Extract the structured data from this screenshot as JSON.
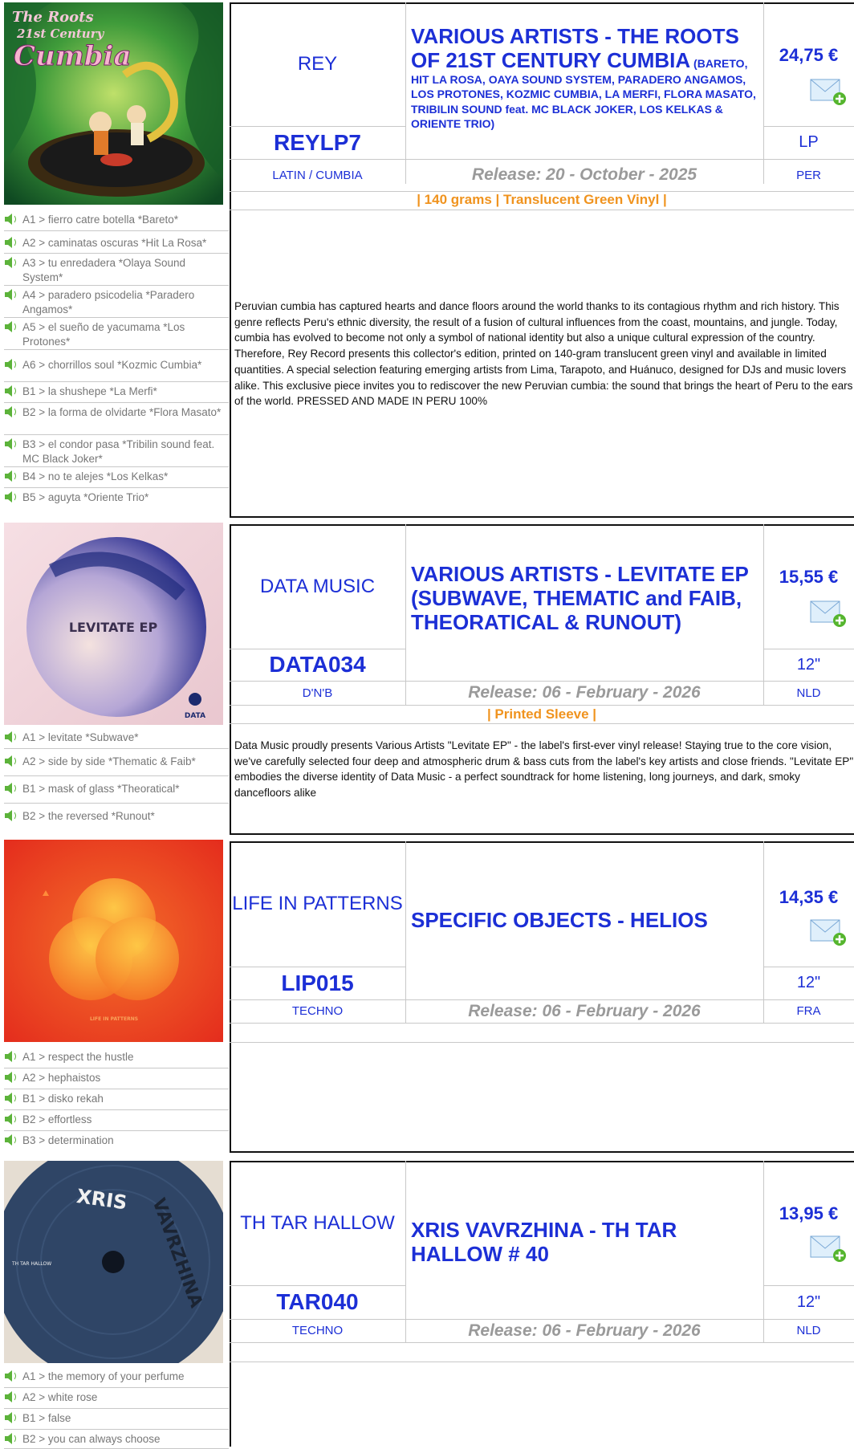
{
  "products": [
    {
      "label": "REY",
      "catalog": "REYLP7",
      "genre": "LATIN / CUMBIA",
      "release": "Release: 20 - October - 2025",
      "format": "LP",
      "country": "PER",
      "price": "24,75 €",
      "title_main": "VARIOUS ARTISTS - THE ROOTS OF 21ST CENTURY CUMBIA",
      "title_small": " (BARETO, HIT LA ROSA, OAYA SOUND SYSTEM, PARADERO ANGAMOS, LOS PROTONES, KOZMIC CUMBIA, LA MERFI, FLORA MASATO, TRIBILIN SOUND feat. MC BLACK JOKER, LOS KELKAS & ORIENTE TRIO)",
      "notes": "| 140 grams | Translucent Green Vinyl |",
      "cover_text": [
        "The Roots",
        "21st Century",
        "Cumbia"
      ],
      "description": "Peruvian cumbia has captured hearts and dance floors around the world thanks to its contagious rhythm and rich history. This genre reflects Peru's ethnic diversity, the result of a fusion of cultural influences from the coast, mountains, and jungle. Today, cumbia has evolved to become not only a symbol of national identity but also a unique cultural expression of the country. Therefore, Rey Record presents this collector's edition, printed on 140-gram translucent green vinyl and available in limited quantities. A special selection featuring emerging artists from Lima, Tarapoto, and Huánuco, designed for DJs and music lovers alike. This exclusive piece invites you to rediscover the new Peruvian cumbia: the sound that brings the heart of Peru to the ears of the world. PRESSED AND MADE IN PERU 100%",
      "tracks": [
        "A1 > fierro catre botella *Bareto*",
        "A2 > caminatas oscuras *Hit La Rosa*",
        "A3 > tu enredadera *Olaya Sound System*",
        "A4 > paradero psicodelia *Paradero Angamos*",
        "A5 > el sueño de yacumama *Los Protones*",
        "A6 > chorrillos soul *Kozmic Cumbia*",
        "B1 > la shushepe *La Merfi*",
        "B2 > la forma de olvidarte *Flora Masato*",
        "B3 > el condor pasa *Tribilin sound feat. MC Black Joker*",
        "B4 > no te alejes *Los Kelkas*",
        "B5 > aguyta *Oriente Trio*"
      ]
    },
    {
      "label": "DATA MUSIC",
      "catalog": "DATA034",
      "genre": "D'N'B",
      "release": "Release: 06 - February - 2026",
      "format": "12\"",
      "country": "NLD",
      "price": "15,55 €",
      "title_main": "VARIOUS ARTISTS - LEVITATE EP (SUBWAVE, THEMATIC and FAIB, THEORATICAL & RUNOUT)",
      "title_small": "",
      "notes": "| Printed Sleeve |",
      "cover_text": [
        "LEVITATE EP",
        "DATA"
      ],
      "description": "Data Music proudly presents Various Artists \"Levitate EP\" - the label's first-ever vinyl release! Staying true to the core vision, we've carefully selected four deep and atmospheric drum & bass cuts from the label's key artists and close friends. \"Levitate EP\" embodies the diverse identity of Data Music - a perfect soundtrack for home listening, long journeys, and dark, smoky dancefloors alike",
      "tracks": [
        "A1 > levitate *Subwave*",
        "A2 > side by side *Thematic & Faib*",
        "B1 > mask of glass *Theoratical*",
        "B2 > the reversed *Runout*"
      ]
    },
    {
      "label": "LIFE IN PATTERNS",
      "catalog": "LIP015",
      "genre": "TECHNO",
      "release": "Release: 06 - February - 2026",
      "format": "12\"",
      "country": "FRA",
      "price": "14,35 €",
      "title_main": "SPECIFIC OBJECTS - HELIOS",
      "title_small": "",
      "notes": "",
      "cover_text": [
        "LIFE IN PATTERNS"
      ],
      "description": "",
      "tracks": [
        "A1 > respect the hustle",
        "A2 > hephaistos",
        "B1 > disko rekah",
        "B2 > effortless",
        "B3 > determination"
      ]
    },
    {
      "label": "TH TAR HALLOW",
      "catalog": "TAR040",
      "genre": "TECHNO",
      "release": "Release: 06 - February - 2026",
      "format": "12\"",
      "country": "NLD",
      "price": "13,95 €",
      "title_main": "XRIS VAVRZHINA - TH TAR HALLOW # 40",
      "title_small": "",
      "notes": "",
      "cover_text": [
        "XRIS",
        "VAVRZHINA",
        "TH TAR HALLOW"
      ],
      "description": "",
      "tracks": [
        "A1 > the memory of your perfume",
        "A2 > white rose",
        "B1 > false",
        "B2 > you can always choose"
      ]
    }
  ]
}
